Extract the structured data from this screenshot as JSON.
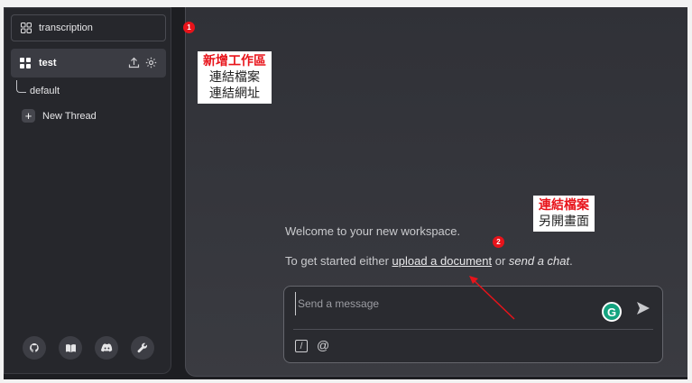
{
  "sidebar": {
    "search_label": "transcription",
    "workspace": {
      "name": "test",
      "upload_icon": "upload-icon",
      "settings_icon": "gear-icon"
    },
    "thread": {
      "name": "default"
    },
    "new_thread_label": "New Thread",
    "footer_icons": [
      "github-icon",
      "book-icon",
      "discord-icon",
      "wrench-icon"
    ]
  },
  "main": {
    "welcome_text": "Welcome to your new workspace.",
    "getstarted_prefix": "To get started either ",
    "upload_link": "upload a document",
    "getstarted_or": " or ",
    "send_chat": "send a chat",
    "getstarted_suffix": "."
  },
  "chat": {
    "placeholder": "Send a message",
    "grammarly_letter": "G",
    "slash_label": "/",
    "at_label": "@"
  },
  "annotations": {
    "badge1": "1",
    "badge2": "2",
    "box1": {
      "title": "新增工作區",
      "lines": [
        "連結檔案",
        "連結網址"
      ]
    },
    "box2": {
      "title": "連結檔案",
      "lines": [
        "另開畫面"
      ]
    }
  },
  "colors": {
    "annotation_red": "#e8131a",
    "grammarly_green": "#14a37f",
    "sidebar_bg": "#26272c",
    "main_bg": "#303137"
  }
}
